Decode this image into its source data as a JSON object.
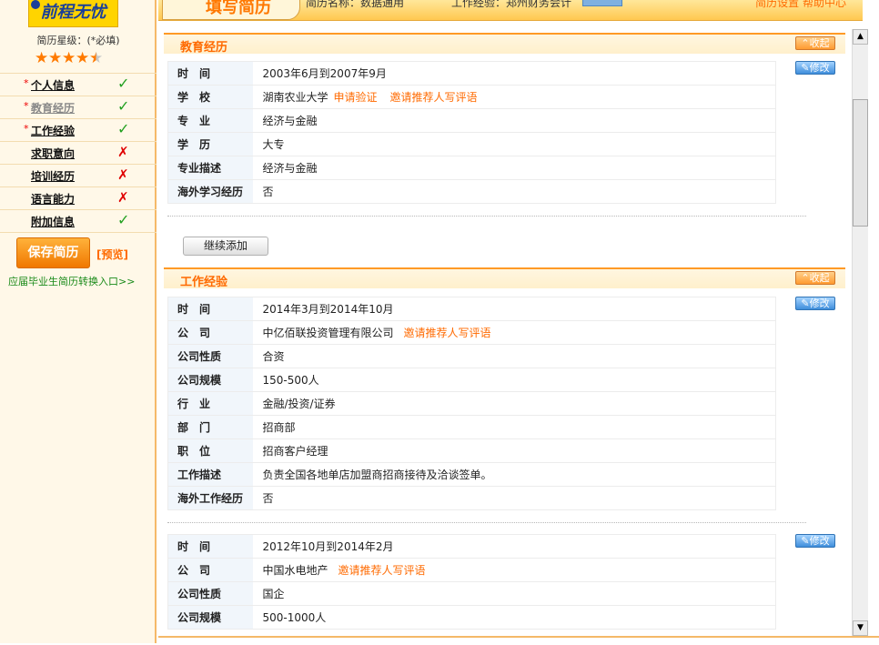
{
  "logo": {
    "text": "前程无忧"
  },
  "sidebar": {
    "star_label": "简历星级：(*必填)",
    "rating_stars": 4.5,
    "items": [
      {
        "label": "个人信息",
        "required": "*",
        "status": "done"
      },
      {
        "label": "教育经历",
        "required": "*",
        "status": "done",
        "current": true
      },
      {
        "label": "工作经验",
        "required": "*",
        "status": "done"
      },
      {
        "label": "求职意向",
        "required": "",
        "status": "missing"
      },
      {
        "label": "培训经历",
        "required": "",
        "status": "missing"
      },
      {
        "label": "语言能力",
        "required": "",
        "status": "missing"
      },
      {
        "label": "附加信息",
        "required": "",
        "status": "done"
      }
    ],
    "save_label": "保存简历",
    "preview_label": "[预览]",
    "graduate_link": "应届毕业生简历转换入口>>"
  },
  "header": {
    "title": "填写简历",
    "left_text": "简历名称：数据通用",
    "mid_text": "工作经验：郑州财务会计",
    "right_text": "简历设置  帮助中心"
  },
  "education": {
    "title": "教育经历",
    "collapse_label": "收起",
    "modify_label": "修改",
    "rows": [
      {
        "k": "时　间",
        "v": "2003年6月到2007年9月"
      },
      {
        "k": "学　校",
        "v": "湖南农业大学",
        "links": [
          "申请验证",
          "邀请推荐人写评语"
        ]
      },
      {
        "k": "专　业",
        "v": "经济与金融"
      },
      {
        "k": "学　历",
        "v": "大专"
      },
      {
        "k": "专业描述",
        "v": "经济与金融"
      },
      {
        "k": "海外学习经历",
        "v": "否"
      }
    ],
    "continue_label": "继续添加"
  },
  "work": {
    "title": "工作经验",
    "collapse_label": "收起",
    "modify_label": "修改",
    "jobs": [
      {
        "rows": [
          {
            "k": "时　间",
            "v": "2014年3月到2014年10月"
          },
          {
            "k": "公　司",
            "v": "中亿佰联投资管理有限公司",
            "links": [
              "邀请推荐人写评语"
            ]
          },
          {
            "k": "公司性质",
            "v": "合资"
          },
          {
            "k": "公司规模",
            "v": "150-500人"
          },
          {
            "k": "行　业",
            "v": "金融/投资/证券"
          },
          {
            "k": "部　门",
            "v": "招商部"
          },
          {
            "k": "职　位",
            "v": "招商客户经理"
          },
          {
            "k": "工作描述",
            "v": "负责全国各地单店加盟商招商接待及洽谈签单。"
          },
          {
            "k": "海外工作经历",
            "v": "否"
          }
        ]
      },
      {
        "rows": [
          {
            "k": "时　间",
            "v": "2012年10月到2014年2月"
          },
          {
            "k": "公　司",
            "v": "中国水电地产",
            "links": [
              "邀请推荐人写评语"
            ]
          },
          {
            "k": "公司性质",
            "v": "国企"
          },
          {
            "k": "公司规模",
            "v": "500-1000人"
          }
        ]
      }
    ]
  },
  "colors": {
    "accent": "#ff6a00",
    "check": "#22a020",
    "cross": "#e00000",
    "modify": "#3f8edb"
  }
}
